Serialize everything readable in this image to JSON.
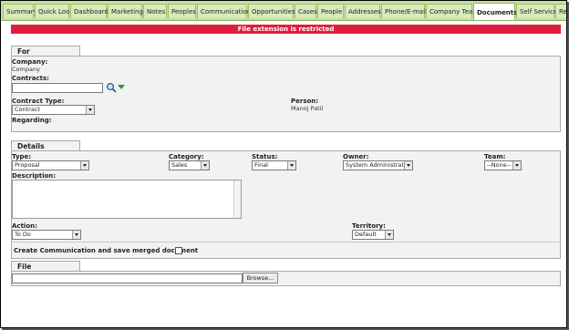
{
  "tabs": [
    {
      "label": "Summary"
    },
    {
      "label": "Quick Look"
    },
    {
      "label": "Dashboard"
    },
    {
      "label": "Marketing"
    },
    {
      "label": "Notes"
    },
    {
      "label": "Peoples"
    },
    {
      "label": "Communications"
    },
    {
      "label": "Opportunities"
    },
    {
      "label": "Cases"
    },
    {
      "label": "People"
    },
    {
      "label": "Addresses"
    },
    {
      "label": "Phone/E-mail"
    },
    {
      "label": "Company Team"
    },
    {
      "label": "Documents",
      "active": true
    },
    {
      "label": "Self Service"
    },
    {
      "label": "Re"
    }
  ],
  "banner": {
    "message": "File extension is restricted",
    "color": "#e21c3c"
  },
  "for_section": {
    "title": "For",
    "company_label": "Company:",
    "company_value": "Company",
    "contracts_label": "Contracts:",
    "contracts_value": "",
    "search_icon": "magnifier-icon",
    "dropdown_icon": "green-triangle-icon",
    "contract_type_label": "Contract Type:",
    "contract_type_value": "Contract",
    "person_label": "Person:",
    "person_value": "Manoj Patil",
    "regarding_label": "Regarding:"
  },
  "details_section": {
    "title": "Details",
    "type_label": "Type:",
    "type_value": "Proposal",
    "category_label": "Category:",
    "category_value": "Sales",
    "status_label": "Status:",
    "status_value": "Final",
    "owner_label": "Owner:",
    "owner_value": "System Administrator",
    "team_label": "Team:",
    "team_value": "--None--",
    "description_label": "Description:",
    "description_value": "",
    "action_label": "Action:",
    "action_value": "To Do",
    "territory_label": "Territory:",
    "territory_value": "Default",
    "merge_label": "Create Communication and save merged document",
    "merge_checked": false
  },
  "file_section": {
    "title": "File",
    "file_value": "",
    "browse_label": "Browse..."
  }
}
